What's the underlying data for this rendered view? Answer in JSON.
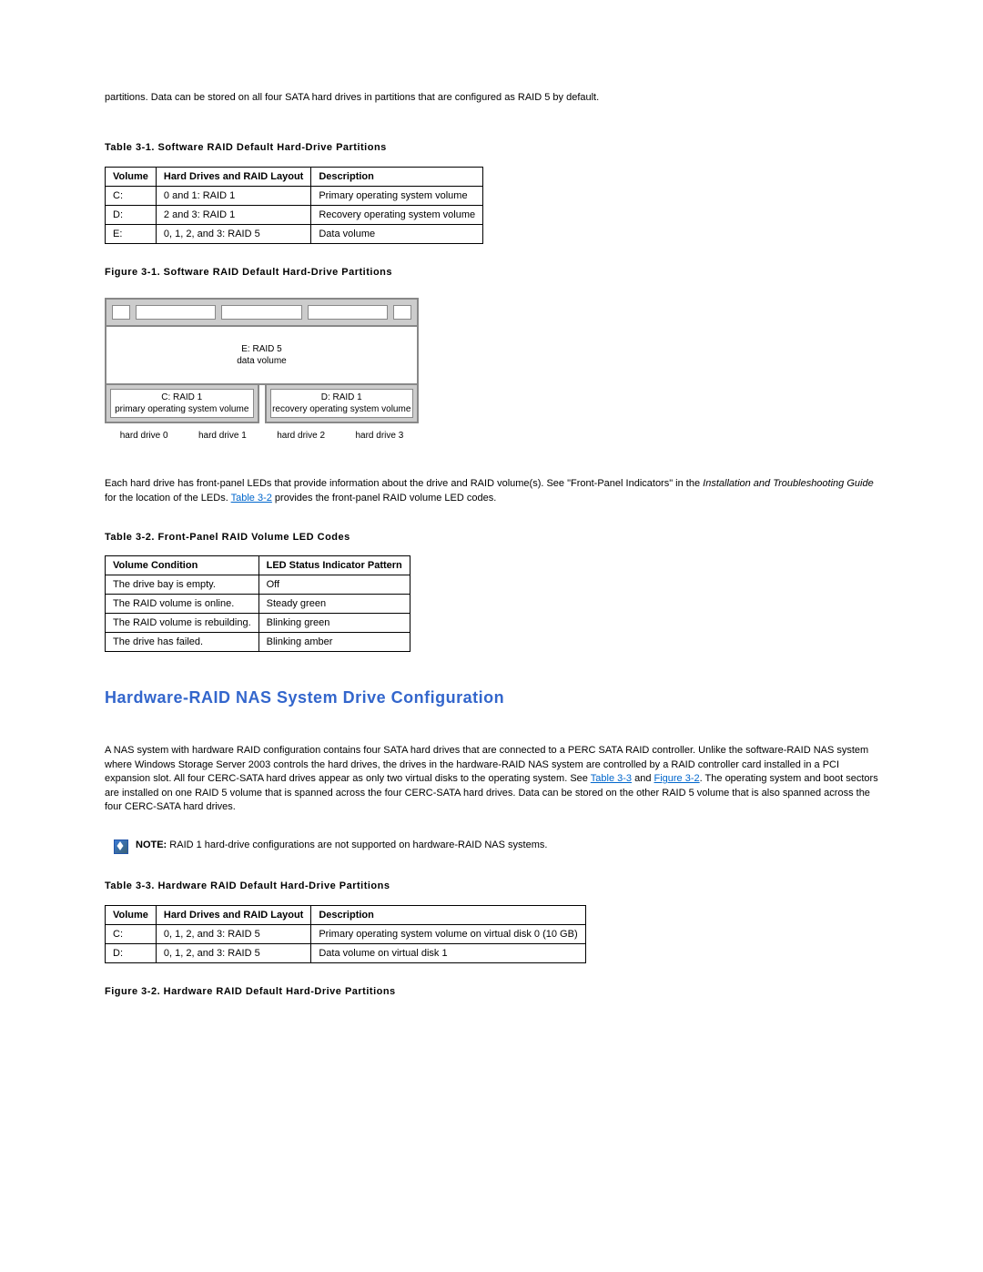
{
  "introText": "partitions. Data can be stored on all four SATA hard drives in partitions that are configured as RAID 5 by default.",
  "table31": {
    "caption": "Table 3-1. Software RAID Default Hard-Drive Partitions",
    "headers": [
      "Volume",
      "Hard Drives and RAID Layout",
      "Description"
    ],
    "rows": [
      [
        "C:",
        "0 and 1: RAID 1",
        "Primary operating system volume"
      ],
      [
        "D:",
        "2 and 3: RAID 1",
        "Recovery operating system volume"
      ],
      [
        "E:",
        "0, 1, 2, and 3: RAID 5",
        "Data volume"
      ]
    ]
  },
  "figure31": {
    "caption": "Figure 3-1. Software RAID Default Hard-Drive Partitions",
    "eLabel1": "E: RAID 5",
    "eLabel2": "data volume",
    "cLabel1": "C: RAID 1",
    "cLabel2": "primary operating system volume",
    "dLabel1": "D: RAID 1",
    "dLabel2": "recovery operating system volume",
    "drives": [
      "hard drive 0",
      "hard drive 1",
      "hard drive 2",
      "hard drive 3"
    ]
  },
  "ledPara": {
    "pre": "Each hard drive has front-panel LEDs that provide information about the drive and RAID volume(s). See \"Front-Panel Indicators\" in the ",
    "italic": "Installation and Troubleshooting Guide",
    "mid": " for the location of the LEDs. ",
    "link": "Table 3-2",
    "post": " provides the front-panel RAID volume LED codes."
  },
  "table32": {
    "caption": "Table 3-2. Front-Panel RAID Volume LED Codes",
    "headers": [
      "Volume Condition",
      "LED Status Indicator Pattern"
    ],
    "rows": [
      [
        "The drive bay is empty.",
        "Off"
      ],
      [
        "The RAID volume is online.",
        "Steady green"
      ],
      [
        "The RAID volume is rebuilding.",
        "Blinking green"
      ],
      [
        "The drive has failed.",
        "Blinking amber"
      ]
    ]
  },
  "sectionHeading": "Hardware-RAID NAS System Drive Configuration",
  "hwPara": {
    "pre": "A NAS system with hardware RAID configuration contains four SATA hard drives that are connected to a PERC SATA RAID controller. Unlike the software-RAID NAS system where Windows Storage Server 2003 controls the hard drives, the drives in the hardware-RAID NAS system are controlled by a RAID controller card installed in a PCI expansion slot. All four CERC-SATA hard drives appear as only two virtual disks to the operating system. See ",
    "link1": "Table 3-3",
    "mid1": " and ",
    "link2": "Figure 3-2",
    "post": ". The operating system and boot sectors are installed on one RAID 5 volume that is spanned across the four CERC-SATA hard drives. Data can be stored on the other RAID 5 volume that is also spanned across the four CERC-SATA hard drives."
  },
  "note": {
    "label": "NOTE:",
    "text": " RAID 1 hard-drive configurations are not supported on hardware-RAID NAS systems."
  },
  "table33": {
    "caption": "Table 3-3. Hardware RAID Default Hard-Drive Partitions",
    "headers": [
      "Volume",
      "Hard Drives and RAID Layout",
      "Description"
    ],
    "rows": [
      [
        "C:",
        "0, 1, 2, and 3: RAID 5",
        "Primary operating system volume on virtual disk 0 (10 GB)"
      ],
      [
        "D:",
        "0, 1, 2, and 3: RAID 5",
        "Data volume on virtual disk 1"
      ]
    ]
  },
  "figure32Caption": "Figure 3-2. Hardware RAID Default Hard-Drive Partitions"
}
